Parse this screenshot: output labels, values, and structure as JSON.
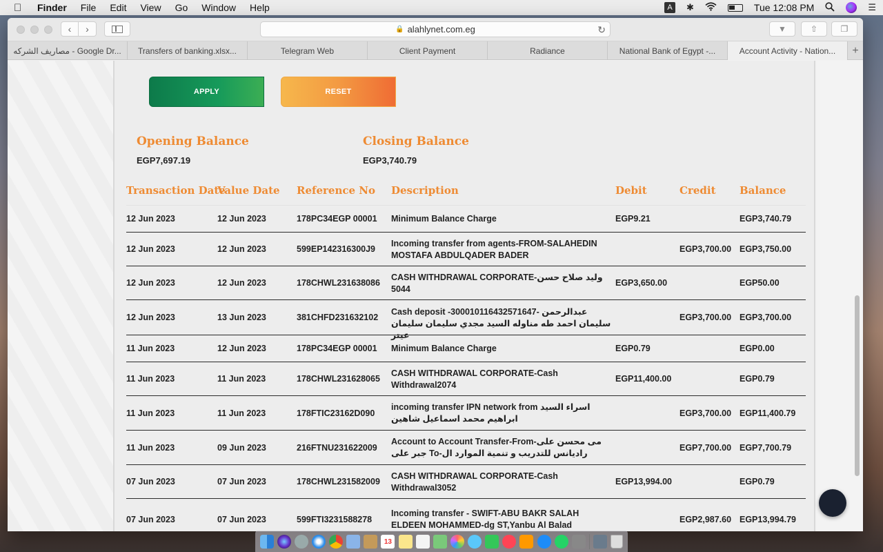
{
  "menubar": {
    "app_name": "Finder",
    "menus": [
      "File",
      "Edit",
      "View",
      "Go",
      "Window",
      "Help"
    ],
    "input_source": "A",
    "clock": "Tue 12:08 PM"
  },
  "browser": {
    "url": "alahlynet.com.eg",
    "tabs": [
      "مصاريف الشركه - Google Dr...",
      "Transfers of banking.xlsx...",
      "Telegram Web",
      "Client Payment",
      "Radiance",
      "National Bank of Egypt -...",
      "Account Activity - Nation..."
    ],
    "active_tab_index": 6
  },
  "filters": {
    "apply_label": "APPLY",
    "reset_label": "RESET"
  },
  "balances": {
    "opening_label": "Opening Balance",
    "opening_value": "EGP7,697.19",
    "closing_label": "Closing Balance",
    "closing_value": "EGP3,740.79"
  },
  "table": {
    "headers": [
      "Transaction Date",
      "Value Date",
      "Reference No",
      "Description",
      "Debit",
      "Credit",
      "Balance"
    ],
    "rows": [
      {
        "tdate": "12 Jun 2023",
        "vdate": "12 Jun 2023",
        "ref": "178PC34EGP 00001",
        "desc": "Minimum Balance Charge",
        "debit": "EGP9.21",
        "credit": "",
        "balance": "EGP3,740.79"
      },
      {
        "tdate": "12 Jun 2023",
        "vdate": "12 Jun 2023",
        "ref": "599EP142316300J9",
        "desc": "Incoming transfer from agents-FROM-SALAHEDIN MOSTAFA ABDULQADER BADER",
        "debit": "",
        "credit": "EGP3,700.00",
        "balance": "EGP3,750.00"
      },
      {
        "tdate": "12 Jun 2023",
        "vdate": "12 Jun 2023",
        "ref": "178CHWL231638086",
        "desc": "CASH WITHDRAWAL CORPORATE-وليد صلاح حسن 5044",
        "debit": "EGP3,650.00",
        "credit": "",
        "balance": "EGP50.00"
      },
      {
        "tdate": "12 Jun 2023",
        "vdate": "13 Jun 2023",
        "ref": "381CHFD231632102",
        "desc": "Cash deposit -300010116432571647- عبدالرحمن سليمان احمد طه مناوله السيد مجدي سليمان سليمان عيتر",
        "debit": "",
        "credit": "EGP3,700.00",
        "balance": "EGP3,700.00"
      },
      {
        "tdate": "11 Jun 2023",
        "vdate": "12 Jun 2023",
        "ref": "178PC34EGP 00001",
        "desc": "Minimum Balance Charge",
        "debit": "EGP0.79",
        "credit": "",
        "balance": "EGP0.00"
      },
      {
        "tdate": "11 Jun 2023",
        "vdate": "11 Jun 2023",
        "ref": "178CHWL231628065",
        "desc": "CASH WITHDRAWAL CORPORATE-Cash Withdrawal2074",
        "debit": "EGP11,400.00",
        "credit": "",
        "balance": "EGP0.79"
      },
      {
        "tdate": "11 Jun 2023",
        "vdate": "11 Jun 2023",
        "ref": "178FTIC23162D090",
        "desc": "incoming transfer IPN network from اسراء السيد ابراهيم محمد اسماعيل شاهين",
        "debit": "",
        "credit": "EGP3,700.00",
        "balance": "EGP11,400.79"
      },
      {
        "tdate": "11 Jun 2023",
        "vdate": "09 Jun 2023",
        "ref": "216FTNU231622009",
        "desc": "Account to Account Transfer-From-مى محسن على جبر على To-راديانس للتدريب و تنمية الموارد ال",
        "debit": "",
        "credit": "EGP7,700.00",
        "balance": "EGP7,700.79"
      },
      {
        "tdate": "07 Jun 2023",
        "vdate": "07 Jun 2023",
        "ref": "178CHWL231582009",
        "desc": "CASH WITHDRAWAL CORPORATE-Cash Withdrawal3052",
        "debit": "EGP13,994.00",
        "credit": "",
        "balance": "EGP0.79"
      },
      {
        "tdate": "07 Jun 2023",
        "vdate": "07 Jun 2023",
        "ref": "599FTI3231588278",
        "desc": "Incoming transfer - SWIFT-ABU BAKR SALAH ELDEEN MOHAMMED-dg ST,Yanbu Al Balad",
        "debit": "",
        "credit": "EGP2,987.60",
        "balance": "EGP13,994.79"
      }
    ]
  },
  "dock": {
    "calendar_day": "13"
  }
}
